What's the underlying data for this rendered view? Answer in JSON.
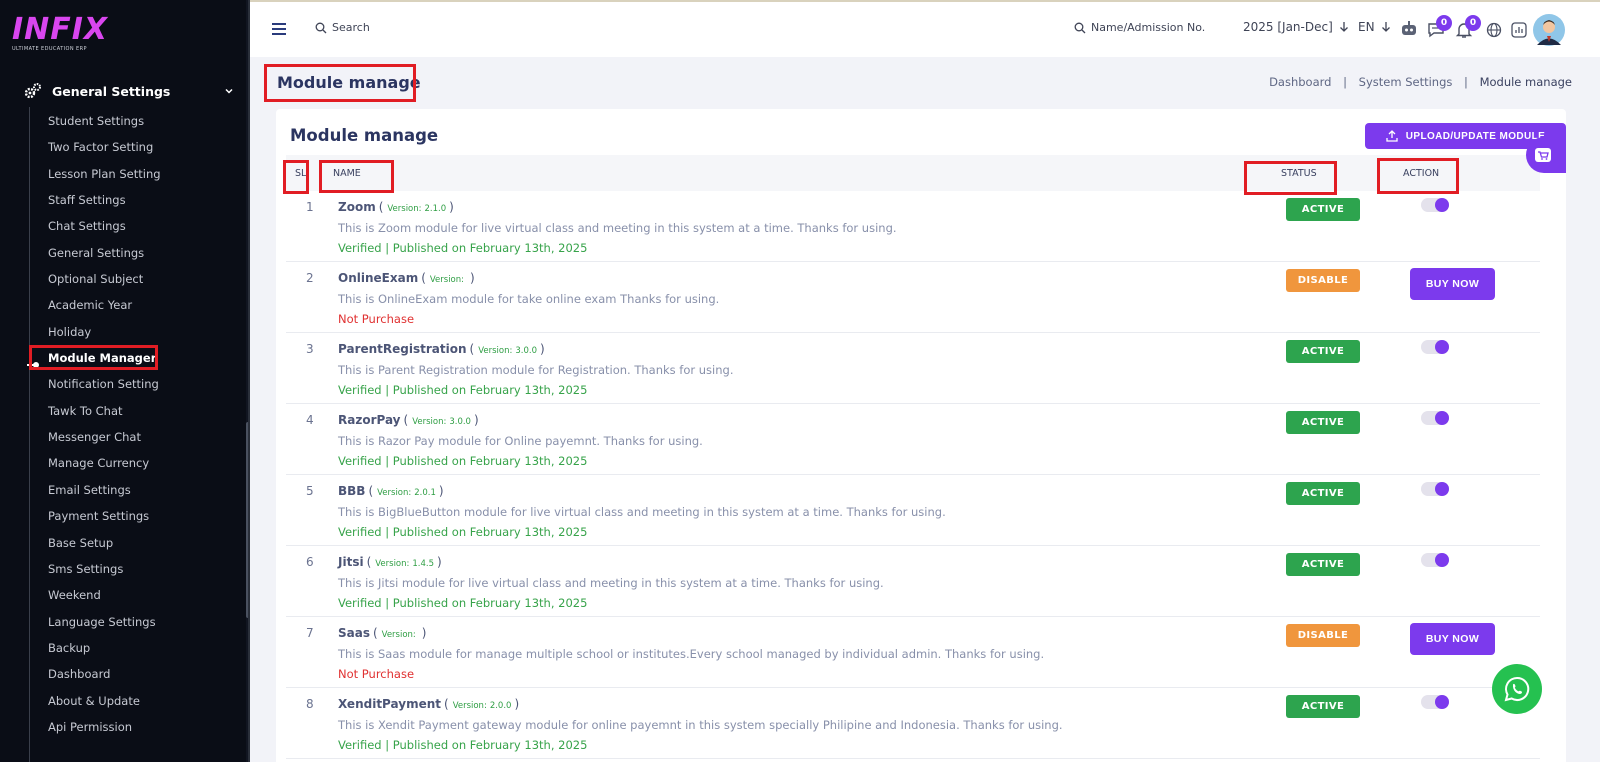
{
  "brand": {
    "name": "INFIX",
    "tagline": "ULTIMATE EDUCATION ERP",
    "accent": "#7c3aed"
  },
  "sidebar": {
    "section_label": "General Settings",
    "items": [
      {
        "label": "Student Settings"
      },
      {
        "label": "Two Factor Setting"
      },
      {
        "label": "Lesson Plan Setting"
      },
      {
        "label": "Staff Settings"
      },
      {
        "label": "Chat Settings"
      },
      {
        "label": "General Settings"
      },
      {
        "label": "Optional Subject"
      },
      {
        "label": "Academic Year"
      },
      {
        "label": "Holiday"
      },
      {
        "label": "Module Manager",
        "active": true
      },
      {
        "label": "Notification Setting"
      },
      {
        "label": "Tawk To Chat"
      },
      {
        "label": "Messenger Chat"
      },
      {
        "label": "Manage Currency"
      },
      {
        "label": "Email Settings"
      },
      {
        "label": "Payment Settings"
      },
      {
        "label": "Base Setup"
      },
      {
        "label": "Sms Settings"
      },
      {
        "label": "Weekend"
      },
      {
        "label": "Language Settings"
      },
      {
        "label": "Backup"
      },
      {
        "label": "Dashboard"
      },
      {
        "label": "About & Update"
      },
      {
        "label": "Api Permission"
      }
    ]
  },
  "topbar": {
    "search_placeholder": "Search",
    "student_search_placeholder": "Name/Admission No.",
    "session": "2025 [Jan-Dec]",
    "language": "EN",
    "chat_count": "0",
    "notification_count": "0"
  },
  "page": {
    "title": "Module manage",
    "breadcrumb": [
      "Dashboard",
      "System Settings",
      "Module manage"
    ],
    "card_title": "Module manage",
    "upload_button": "UPLOAD/UPDATE MODULE"
  },
  "table": {
    "headers": {
      "sl": "SL",
      "name": "NAME",
      "status": "STATUS",
      "action": "ACTION"
    },
    "version_prefix": "Version:",
    "buy_label": "BUY NOW",
    "rows": [
      {
        "sl": "1",
        "name": "Zoom",
        "version": "2.1.0",
        "description": "This is Zoom module for live virtual class and meeting in this system at a time. Thanks for using.",
        "meta": "Verified | Published on February 13th, 2025",
        "meta_type": "ok",
        "status": "ACTIVE",
        "status_type": "active",
        "action": "toggle"
      },
      {
        "sl": "2",
        "name": "OnlineExam",
        "version": "",
        "description": "This is OnlineExam module for take online exam Thanks for using.",
        "meta": "Not Purchase",
        "meta_type": "bad",
        "status": "DISABLE",
        "status_type": "disable",
        "action": "buy"
      },
      {
        "sl": "3",
        "name": "ParentRegistration",
        "version": "3.0.0",
        "description": "This is Parent Registration module for Registration. Thanks for using.",
        "meta": "Verified | Published on February 13th, 2025",
        "meta_type": "ok",
        "status": "ACTIVE",
        "status_type": "active",
        "action": "toggle"
      },
      {
        "sl": "4",
        "name": "RazorPay",
        "version": "3.0.0",
        "description": "This is Razor Pay module for Online payemnt. Thanks for using.",
        "meta": "Verified | Published on February 13th, 2025",
        "meta_type": "ok",
        "status": "ACTIVE",
        "status_type": "active",
        "action": "toggle"
      },
      {
        "sl": "5",
        "name": "BBB",
        "version": "2.0.1",
        "description": "This is BigBlueButton module for live virtual class and meeting in this system at a time. Thanks for using.",
        "meta": "Verified | Published on February 13th, 2025",
        "meta_type": "ok",
        "status": "ACTIVE",
        "status_type": "active",
        "action": "toggle"
      },
      {
        "sl": "6",
        "name": "Jitsi",
        "version": "1.4.5",
        "description": "This is Jitsi module for live virtual class and meeting in this system at a time. Thanks for using.",
        "meta": "Verified | Published on February 13th, 2025",
        "meta_type": "ok",
        "status": "ACTIVE",
        "status_type": "active",
        "action": "toggle"
      },
      {
        "sl": "7",
        "name": "Saas",
        "version": "",
        "description": "This is Saas module for manage multiple school or institutes.Every school managed by individual admin. Thanks for using.",
        "meta": "Not Purchase",
        "meta_type": "bad",
        "status": "DISABLE",
        "status_type": "disable",
        "action": "buy"
      },
      {
        "sl": "8",
        "name": "XenditPayment",
        "version": "2.0.0",
        "description": "This is Xendit Payment gateway module for online payemnt in this system specially Philipine and Indonesia. Thanks for using.",
        "meta": "Verified | Published on February 13th, 2025",
        "meta_type": "ok",
        "status": "ACTIVE",
        "status_type": "active",
        "action": "toggle"
      }
    ]
  }
}
